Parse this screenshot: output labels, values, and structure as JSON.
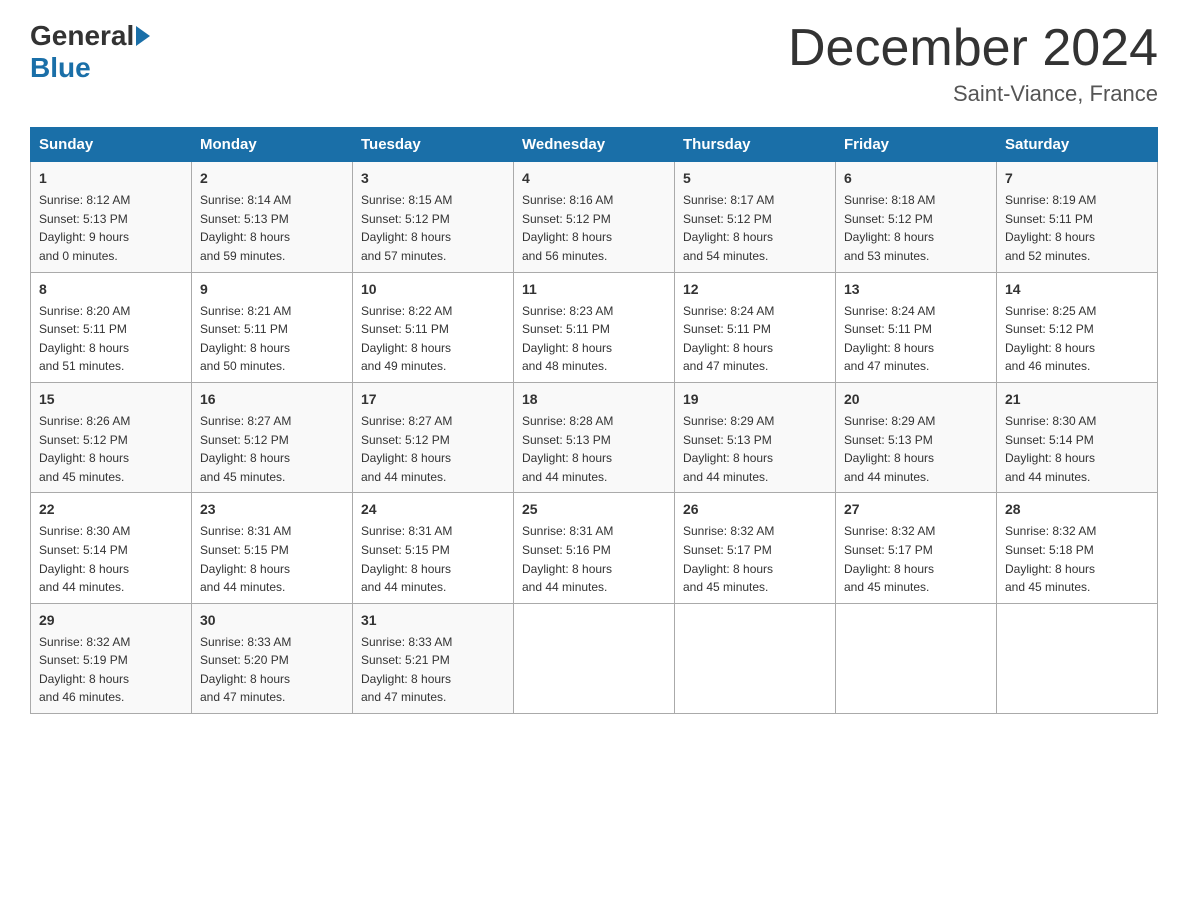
{
  "header": {
    "logo_general": "General",
    "logo_blue": "Blue",
    "title": "December 2024",
    "location": "Saint-Viance, France"
  },
  "columns": [
    "Sunday",
    "Monday",
    "Tuesday",
    "Wednesday",
    "Thursday",
    "Friday",
    "Saturday"
  ],
  "weeks": [
    [
      {
        "day": "1",
        "info": "Sunrise: 8:12 AM\nSunset: 5:13 PM\nDaylight: 9 hours\nand 0 minutes."
      },
      {
        "day": "2",
        "info": "Sunrise: 8:14 AM\nSunset: 5:13 PM\nDaylight: 8 hours\nand 59 minutes."
      },
      {
        "day": "3",
        "info": "Sunrise: 8:15 AM\nSunset: 5:12 PM\nDaylight: 8 hours\nand 57 minutes."
      },
      {
        "day": "4",
        "info": "Sunrise: 8:16 AM\nSunset: 5:12 PM\nDaylight: 8 hours\nand 56 minutes."
      },
      {
        "day": "5",
        "info": "Sunrise: 8:17 AM\nSunset: 5:12 PM\nDaylight: 8 hours\nand 54 minutes."
      },
      {
        "day": "6",
        "info": "Sunrise: 8:18 AM\nSunset: 5:12 PM\nDaylight: 8 hours\nand 53 minutes."
      },
      {
        "day": "7",
        "info": "Sunrise: 8:19 AM\nSunset: 5:11 PM\nDaylight: 8 hours\nand 52 minutes."
      }
    ],
    [
      {
        "day": "8",
        "info": "Sunrise: 8:20 AM\nSunset: 5:11 PM\nDaylight: 8 hours\nand 51 minutes."
      },
      {
        "day": "9",
        "info": "Sunrise: 8:21 AM\nSunset: 5:11 PM\nDaylight: 8 hours\nand 50 minutes."
      },
      {
        "day": "10",
        "info": "Sunrise: 8:22 AM\nSunset: 5:11 PM\nDaylight: 8 hours\nand 49 minutes."
      },
      {
        "day": "11",
        "info": "Sunrise: 8:23 AM\nSunset: 5:11 PM\nDaylight: 8 hours\nand 48 minutes."
      },
      {
        "day": "12",
        "info": "Sunrise: 8:24 AM\nSunset: 5:11 PM\nDaylight: 8 hours\nand 47 minutes."
      },
      {
        "day": "13",
        "info": "Sunrise: 8:24 AM\nSunset: 5:11 PM\nDaylight: 8 hours\nand 47 minutes."
      },
      {
        "day": "14",
        "info": "Sunrise: 8:25 AM\nSunset: 5:12 PM\nDaylight: 8 hours\nand 46 minutes."
      }
    ],
    [
      {
        "day": "15",
        "info": "Sunrise: 8:26 AM\nSunset: 5:12 PM\nDaylight: 8 hours\nand 45 minutes."
      },
      {
        "day": "16",
        "info": "Sunrise: 8:27 AM\nSunset: 5:12 PM\nDaylight: 8 hours\nand 45 minutes."
      },
      {
        "day": "17",
        "info": "Sunrise: 8:27 AM\nSunset: 5:12 PM\nDaylight: 8 hours\nand 44 minutes."
      },
      {
        "day": "18",
        "info": "Sunrise: 8:28 AM\nSunset: 5:13 PM\nDaylight: 8 hours\nand 44 minutes."
      },
      {
        "day": "19",
        "info": "Sunrise: 8:29 AM\nSunset: 5:13 PM\nDaylight: 8 hours\nand 44 minutes."
      },
      {
        "day": "20",
        "info": "Sunrise: 8:29 AM\nSunset: 5:13 PM\nDaylight: 8 hours\nand 44 minutes."
      },
      {
        "day": "21",
        "info": "Sunrise: 8:30 AM\nSunset: 5:14 PM\nDaylight: 8 hours\nand 44 minutes."
      }
    ],
    [
      {
        "day": "22",
        "info": "Sunrise: 8:30 AM\nSunset: 5:14 PM\nDaylight: 8 hours\nand 44 minutes."
      },
      {
        "day": "23",
        "info": "Sunrise: 8:31 AM\nSunset: 5:15 PM\nDaylight: 8 hours\nand 44 minutes."
      },
      {
        "day": "24",
        "info": "Sunrise: 8:31 AM\nSunset: 5:15 PM\nDaylight: 8 hours\nand 44 minutes."
      },
      {
        "day": "25",
        "info": "Sunrise: 8:31 AM\nSunset: 5:16 PM\nDaylight: 8 hours\nand 44 minutes."
      },
      {
        "day": "26",
        "info": "Sunrise: 8:32 AM\nSunset: 5:17 PM\nDaylight: 8 hours\nand 45 minutes."
      },
      {
        "day": "27",
        "info": "Sunrise: 8:32 AM\nSunset: 5:17 PM\nDaylight: 8 hours\nand 45 minutes."
      },
      {
        "day": "28",
        "info": "Sunrise: 8:32 AM\nSunset: 5:18 PM\nDaylight: 8 hours\nand 45 minutes."
      }
    ],
    [
      {
        "day": "29",
        "info": "Sunrise: 8:32 AM\nSunset: 5:19 PM\nDaylight: 8 hours\nand 46 minutes."
      },
      {
        "day": "30",
        "info": "Sunrise: 8:33 AM\nSunset: 5:20 PM\nDaylight: 8 hours\nand 47 minutes."
      },
      {
        "day": "31",
        "info": "Sunrise: 8:33 AM\nSunset: 5:21 PM\nDaylight: 8 hours\nand 47 minutes."
      },
      {
        "day": "",
        "info": ""
      },
      {
        "day": "",
        "info": ""
      },
      {
        "day": "",
        "info": ""
      },
      {
        "day": "",
        "info": ""
      }
    ]
  ]
}
